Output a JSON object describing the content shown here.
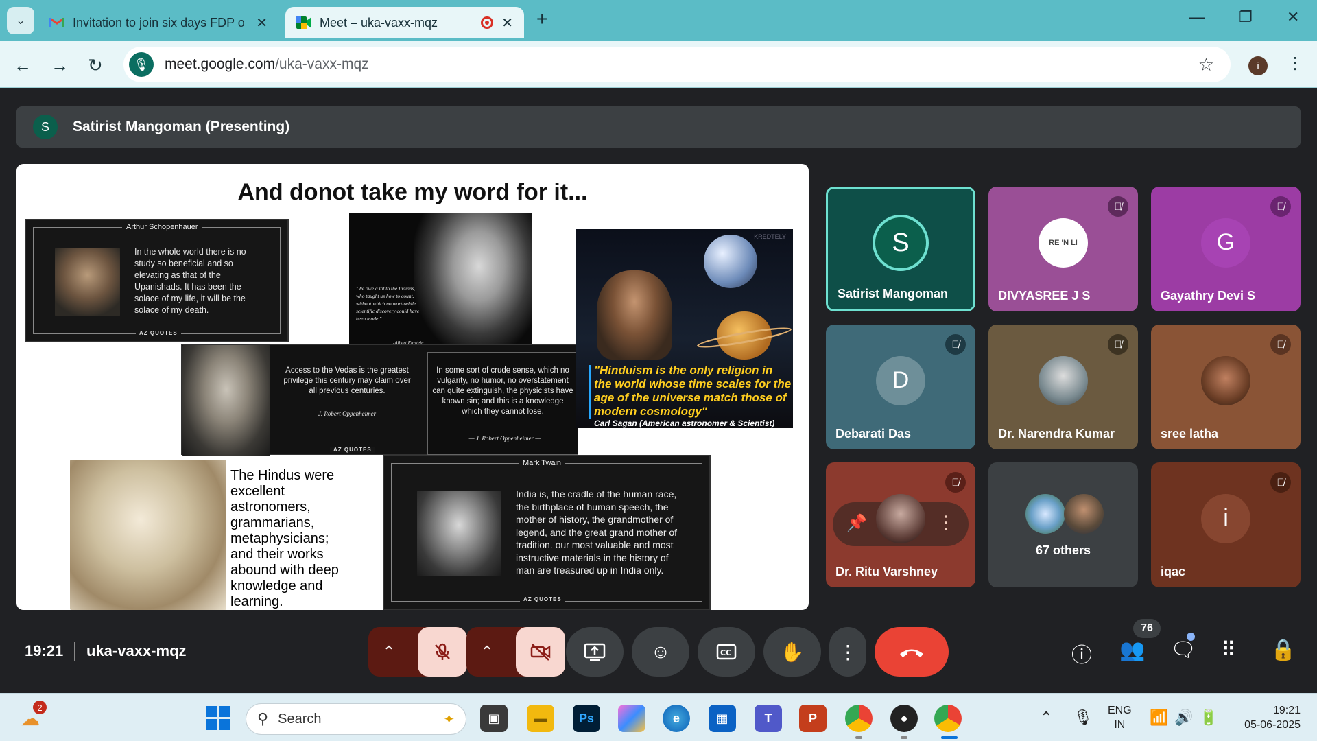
{
  "browser": {
    "tabs": [
      {
        "title": "Invitation to join six days FDP o",
        "icon": "gmail-icon"
      },
      {
        "title": "Meet – uka-vaxx-mqz",
        "icon": "meet-icon",
        "recording": true
      }
    ],
    "address": {
      "host": "meet.google.com",
      "path": "/uka-vaxx-mqz"
    },
    "profile_initial": "i"
  },
  "presenter_bar": {
    "initial": "S",
    "label": "Satirist Mangoman (Presenting)"
  },
  "slide": {
    "title": "And donot take my word for it...",
    "schopenhauer": {
      "head": "Arthur Schopenhauer",
      "text": "In the whole world there is no study so beneficial and so elevating as that of the Upanishads. It has been the solace of my life, it will be the solace of my death.",
      "footer": "AZ QUOTES"
    },
    "einstein": {
      "text": "\"We owe a lot to the Indians, who taught us how to count, without which no worthwhile scientific discovery could have been made.\"",
      "attr": "-Albert Einstein"
    },
    "oppenheimer": {
      "quote1": "Access to the Vedas is the greatest privilege this century may claim over all previous centuries.",
      "sig1": "— J. Robert Oppenheimer —",
      "quote2": "In some sort of crude sense, which no vulgarity, no humor, no overstatement can quite extinguish, the physicists have known sin; and this is a knowledge which they cannot lose.",
      "sig2": "— J. Robert Oppenheimer —",
      "footer": "AZ QUOTES"
    },
    "sagan": {
      "watermark": "KREDTELY",
      "quote": "\"Hinduism is the only religion in the world whose time scales for the age of the universe match those of modern cosmology\"",
      "attr": "Carl Sagan (American astronomer & Scientist)"
    },
    "hindus_text": "The Hindus were excellent astronomers, grammarians, metaphysicians; and their works abound with deep knowledge and learning.",
    "twain": {
      "head": "Mark Twain",
      "text": "India is, the cradle of the human race, the birthplace of human speech, the mother of history, the grandmother of legend, and the great grand mother of tradition. our most valuable and most instructive materials in the history of man are treasured up in India only.",
      "footer": "AZ QUOTES"
    }
  },
  "participants": [
    {
      "name": "Satirist Mangoman",
      "initial": "S",
      "bg": "#0e4f48",
      "circle": "#0b5f4c",
      "muted": false,
      "speaking": true
    },
    {
      "name": "DIVYASREE J S",
      "initial": "",
      "bg": "#9a4f96",
      "circle": "#ffffff",
      "muted": true,
      "avatar_text": "RE 'N LI"
    },
    {
      "name": "Gayathry Devi S",
      "initial": "G",
      "bg": "#9c3ca4",
      "circle": "#a743b3",
      "muted": true
    },
    {
      "name": "Debarati Das",
      "initial": "D",
      "bg": "#3f6a78",
      "circle": "#6e8f99",
      "muted": true
    },
    {
      "name": "Dr. Narendra Kumar",
      "initial": "",
      "bg": "#6b5a40",
      "circle": "#b8b0a0",
      "muted": true
    },
    {
      "name": "sree latha",
      "initial": "",
      "bg": "#8a5436",
      "circle": "#b88060",
      "muted": true
    },
    {
      "name": "Dr. Ritu Varshney",
      "initial": "",
      "bg": "#8c3a2e",
      "circle": "#c2a59c",
      "muted": true,
      "pinned": true
    },
    {
      "name": "67 others",
      "initial": "",
      "bg": "#3c4043",
      "others": true
    },
    {
      "name": "iqac",
      "initial": "i",
      "bg": "#6e3320",
      "circle": "#874630",
      "muted": true
    }
  ],
  "controls": {
    "time": "19:21",
    "meeting_code": "uka-vaxx-mqz",
    "participant_count": "76"
  },
  "taskbar": {
    "weather_badge": "2",
    "search_placeholder": "Search",
    "lang_line1": "ENG",
    "lang_line2": "IN",
    "time": "19:21",
    "date": "05-06-2025"
  },
  "colors": {
    "meet_bg": "#202124",
    "end_call": "#ea4335",
    "accent_teal": "#5bbcc6"
  }
}
